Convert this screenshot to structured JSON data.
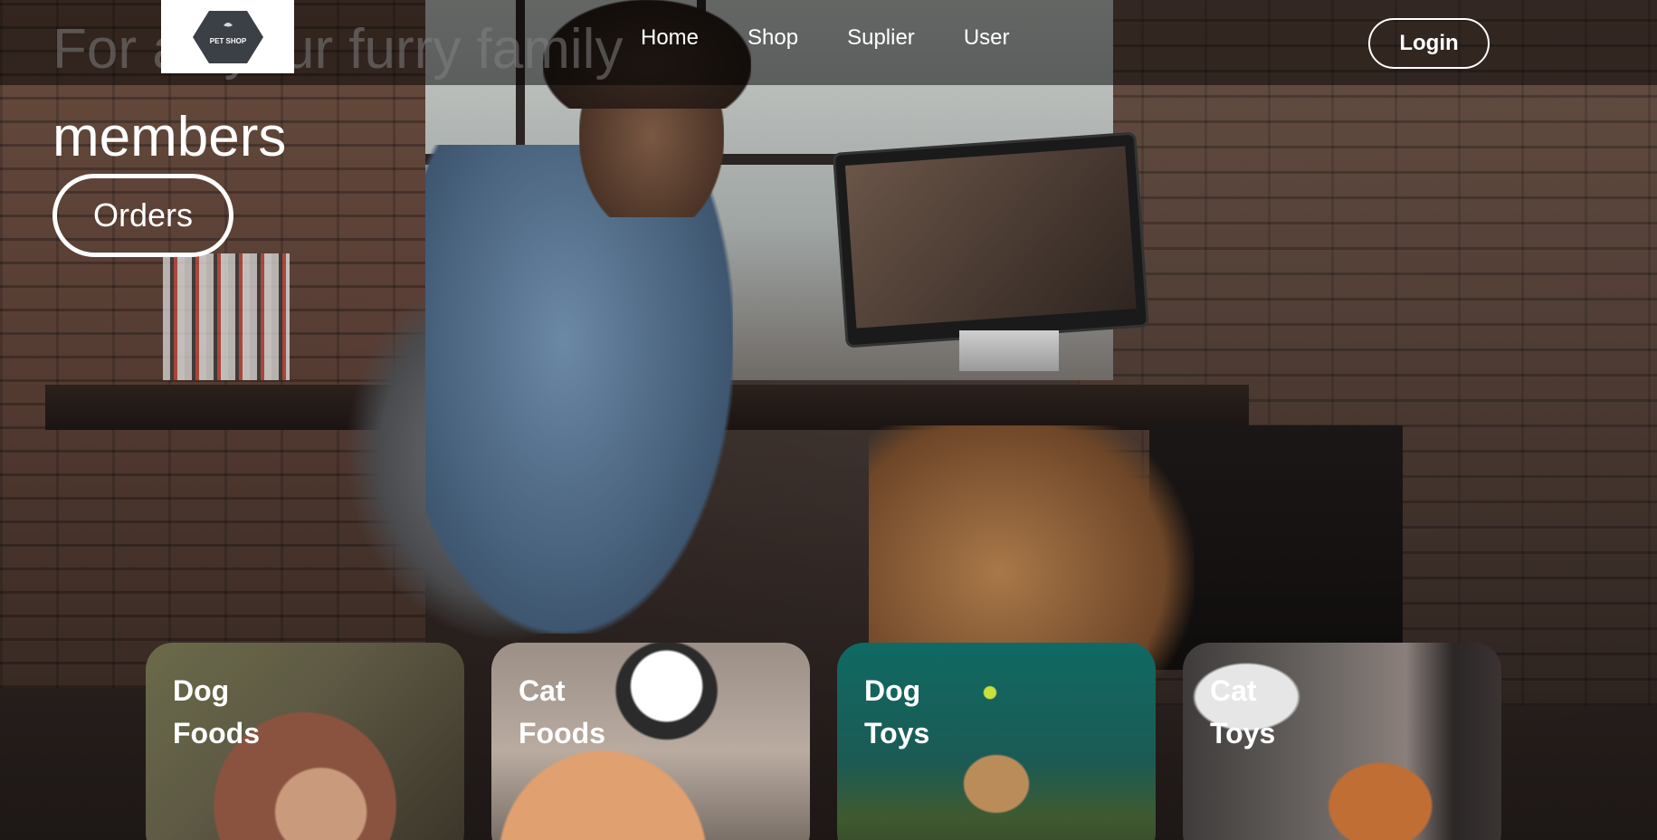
{
  "nav": {
    "logo_text": "PET SHOP",
    "links": [
      "Home",
      "Shop",
      "Suplier",
      "User"
    ],
    "login_label": "Login"
  },
  "hero": {
    "title_line1": "For all your furry family",
    "title_line2": "members",
    "orders_label": "Orders"
  },
  "categories": [
    {
      "line1": "Dog",
      "line2": "Foods"
    },
    {
      "line1": "Cat",
      "line2": "Foods"
    },
    {
      "line1": "Dog",
      "line2": "Toys"
    },
    {
      "line1": "Cat",
      "line2": "Toys"
    }
  ]
}
